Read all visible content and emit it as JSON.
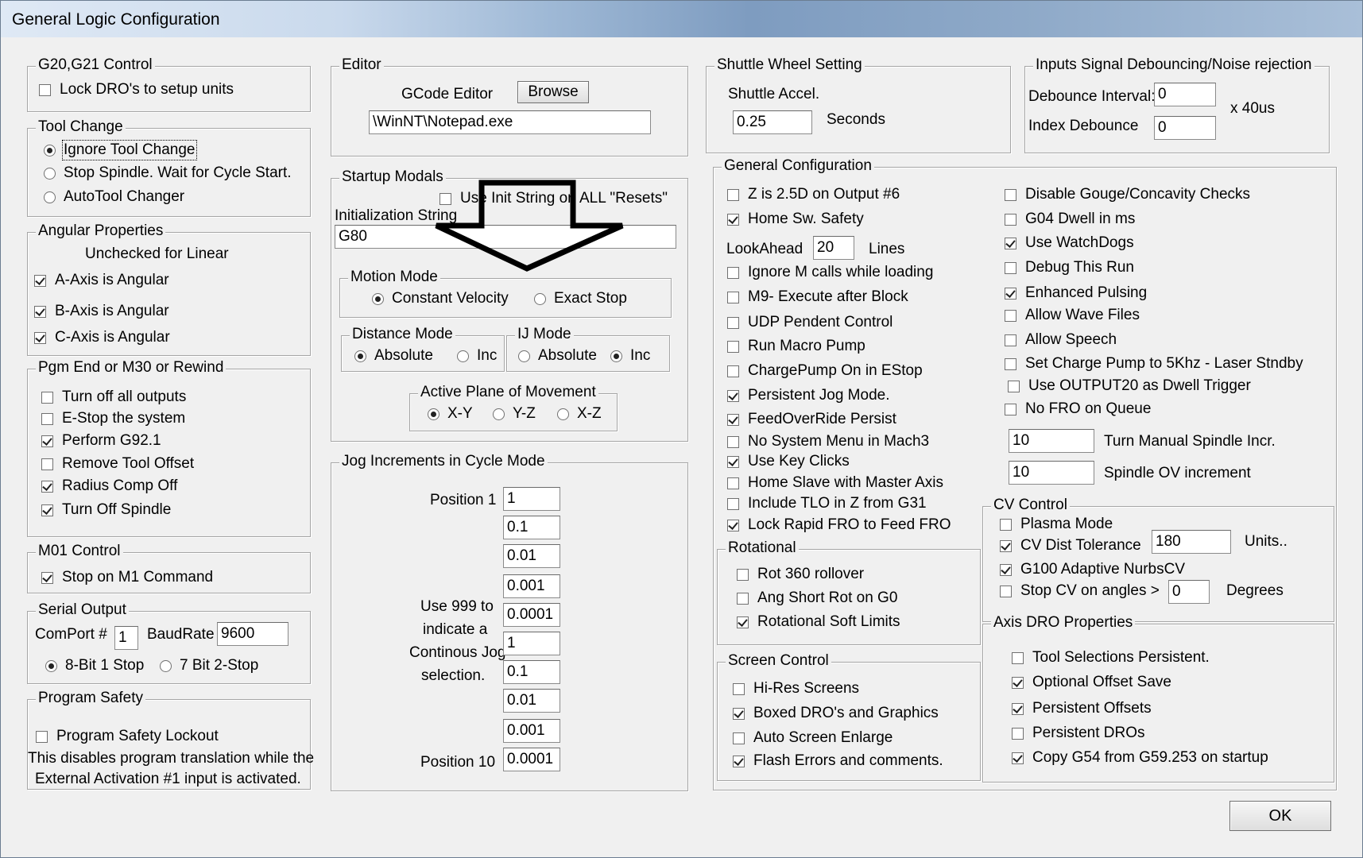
{
  "window": {
    "title": "General Logic Configuration"
  },
  "g20": {
    "legend": "G20,G21 Control",
    "lock": "Lock DRO's to setup units"
  },
  "tool": {
    "legend": "Tool Change",
    "opt1": "Ignore Tool Change",
    "opt2": "Stop Spindle. Wait for Cycle Start.",
    "opt3": "AutoTool Changer"
  },
  "angular": {
    "legend": "Angular Properties",
    "note": "Unchecked for Linear",
    "a": "A-Axis is Angular",
    "b": "B-Axis is Angular",
    "c": "C-Axis is Angular"
  },
  "pgmend": {
    "legend": "Pgm End or M30 or Rewind",
    "items": [
      "Turn off all outputs",
      "E-Stop the system",
      "Perform G92.1",
      "Remove Tool Offset",
      "Radius Comp Off",
      "Turn Off Spindle"
    ]
  },
  "m01": {
    "legend": "M01 Control",
    "stop": "Stop on M1 Command"
  },
  "serial": {
    "legend": "Serial Output",
    "comport_label": "ComPort #",
    "comport": "1",
    "baud_label": "BaudRate",
    "baud": "9600",
    "opt1": "8-Bit 1 Stop",
    "opt2": "7 Bit 2-Stop"
  },
  "safety": {
    "legend": "Program Safety",
    "lockout": "Program Safety Lockout",
    "desc1": "This disables program translation while the",
    "desc2": "External Activation #1 input is activated."
  },
  "editor": {
    "legend": "Editor",
    "label": "GCode Editor",
    "browse": "Browse",
    "path": "\\WinNT\\Notepad.exe"
  },
  "startup": {
    "legend": "Startup Modals",
    "use_init": "Use Init String on ALL  \"Resets\"",
    "init_label": "Initialization String",
    "init_value": "G80"
  },
  "motion": {
    "legend": "Motion Mode",
    "cv": "Constant Velocity",
    "es": "Exact Stop"
  },
  "distance": {
    "legend": "Distance Mode",
    "abs": "Absolute",
    "inc": "Inc"
  },
  "ij": {
    "legend": "IJ Mode",
    "abs": "Absolute",
    "inc": "Inc"
  },
  "plane": {
    "legend": "Active Plane of Movement",
    "xy": "X-Y",
    "yz": "Y-Z",
    "xz": "X-Z"
  },
  "jog": {
    "legend": "Jog Increments in Cycle Mode",
    "pos1": "Position 1",
    "pos10": "Position 10",
    "note1": "Use 999 to",
    "note2": "indicate a",
    "note3": "Continous Jog",
    "note4": "selection.",
    "values": [
      "1",
      "0.1",
      "0.01",
      "0.001",
      "0.0001",
      "1",
      "0.1",
      "0.01",
      "0.001",
      "0.0001"
    ]
  },
  "shuttle": {
    "legend": "Shuttle Wheel Setting",
    "accel_label": "Shuttle Accel.",
    "accel": "0.25",
    "unit": "Seconds"
  },
  "debounce": {
    "legend": "Inputs Signal Debouncing/Noise rejection",
    "interval_label": "Debounce Interval:",
    "interval": "0",
    "index_label": "Index Debounce",
    "index": "0",
    "unit": "x 40us"
  },
  "general": {
    "legend": "General Configuration",
    "z25": "Z is 2.5D on Output #6",
    "home_safety": "Home Sw. Safety",
    "lookahead_label": "LookAhead",
    "lookahead": "20",
    "lines": "Lines",
    "left": [
      "Ignore M calls while loading",
      "M9- Execute after Block",
      "UDP Pendent Control",
      "Run Macro Pump",
      "ChargePump On in EStop",
      "Persistent Jog Mode.",
      "FeedOverRide Persist",
      "No System Menu in Mach3",
      "Use Key Clicks",
      "Home Slave with Master Axis",
      "Include TLO in Z from G31",
      "Lock Rapid FRO to Feed FRO"
    ],
    "right": [
      "Disable Gouge/Concavity Checks",
      "G04 Dwell in ms",
      "Use WatchDogs",
      "Debug This Run",
      "Enhanced Pulsing",
      "Allow Wave Files",
      "Allow Speech",
      "Set Charge Pump to 5Khz  - Laser Stndby",
      "Use OUTPUT20 as Dwell Trigger",
      "No FRO on Queue"
    ],
    "spindle_incr": "10",
    "spindle_incr_label": "Turn Manual Spindle Incr.",
    "spindle_ov": "10",
    "spindle_ov_label": "Spindle OV increment"
  },
  "rotational": {
    "legend": "Rotational",
    "items": [
      "Rot 360 rollover",
      "Ang Short Rot on G0",
      "Rotational Soft Limits"
    ]
  },
  "cv": {
    "legend": "CV Control",
    "plasma": "Plasma Mode",
    "dist": "CV Dist Tolerance",
    "dist_value": "180",
    "units": "Units..",
    "g100": "G100 Adaptive NurbsCV",
    "stop": "Stop CV on angles >",
    "angle": "0",
    "degrees": "Degrees"
  },
  "screen": {
    "legend": "Screen Control",
    "items": [
      "Hi-Res Screens",
      "Boxed DRO's and Graphics",
      "Auto Screen Enlarge",
      "Flash Errors and comments."
    ]
  },
  "axisdro": {
    "legend": "Axis DRO Properties",
    "items": [
      "Tool Selections Persistent.",
      "Optional Offset Save",
      "Persistent Offsets",
      "Persistent DROs",
      "Copy G54 from G59.253 on startup"
    ]
  },
  "ok": "OK"
}
